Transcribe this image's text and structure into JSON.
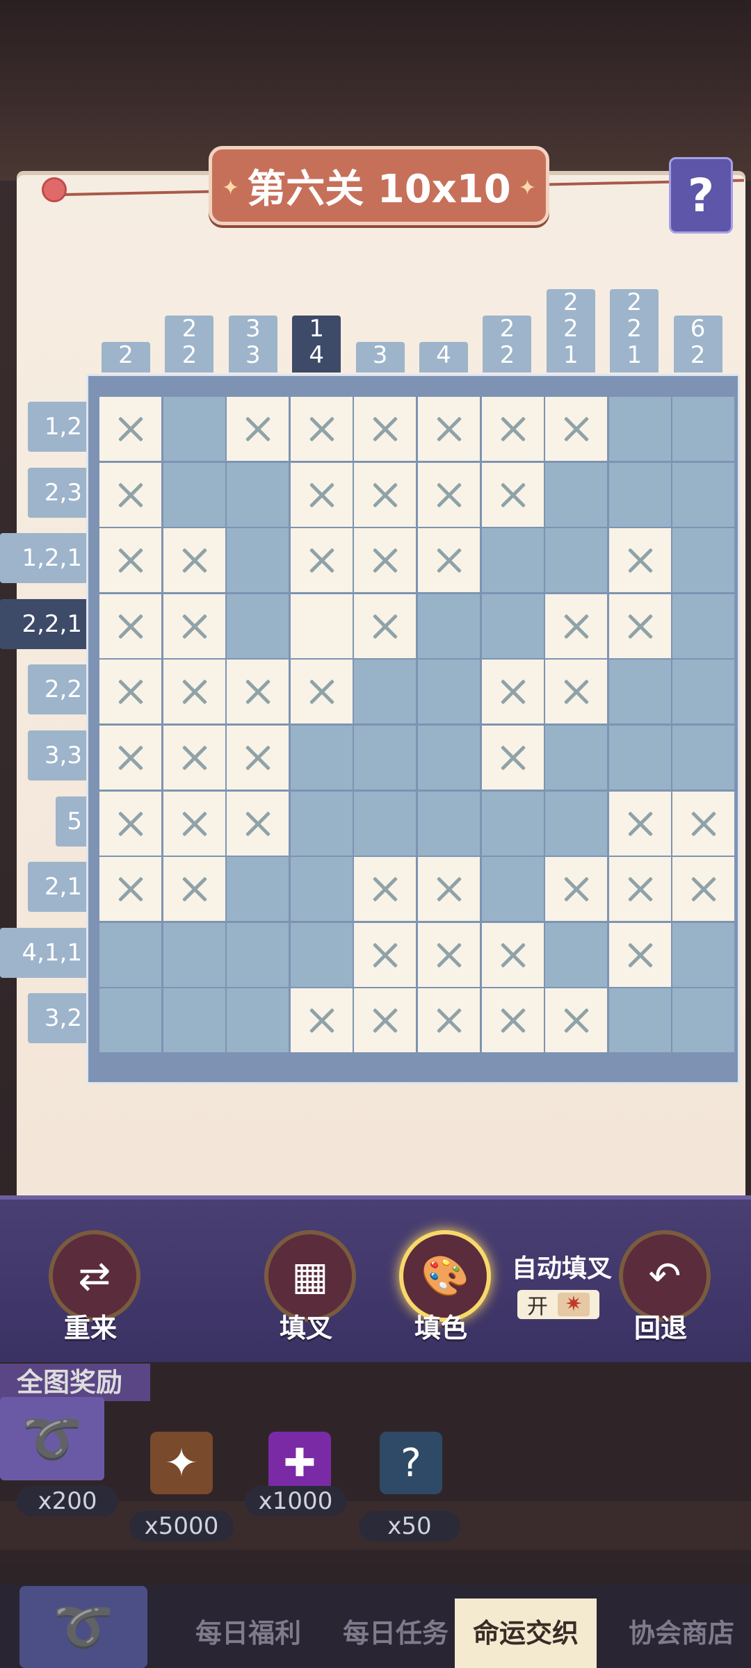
{
  "title": "第六关 10x10",
  "help_label": "?",
  "col_clues": [
    [
      "2"
    ],
    [
      "2",
      "2"
    ],
    [
      "3",
      "3"
    ],
    [
      "1",
      "4"
    ],
    [
      "3"
    ],
    [
      "4"
    ],
    [
      "2",
      "2"
    ],
    [
      "2",
      "2",
      "1"
    ],
    [
      "2",
      "2",
      "1"
    ],
    [
      "6",
      "2"
    ]
  ],
  "selected_col": 3,
  "row_clues": [
    "1,2",
    "2,3",
    "1,2,1",
    "2,2,1",
    "2,2",
    "3,3",
    "5",
    "2,1",
    "4,1,1",
    "3,2"
  ],
  "selected_row": 3,
  "grid": [
    "XFXXXXXXFF",
    "XFFXXXXFFF",
    "XXFXXXFFXF",
    "XXFEXFFXXF",
    "XXXXFFXXFF",
    "XXXFFFXFFF",
    "XXXFFFFFXX",
    "XXFFXXFXXX",
    "FFFFXXXFXF",
    "FFFXXXXXFF"
  ],
  "tools": {
    "reset": {
      "label": "重来",
      "icon": "reset-arrows-icon"
    },
    "cross": {
      "label": "填叉",
      "icon": "cross-grid-icon"
    },
    "color": {
      "label": "填色",
      "icon": "palette-icon"
    },
    "undo": {
      "label": "回退",
      "icon": "undo-icon"
    }
  },
  "auto_cross": {
    "label": "自动填叉",
    "state": "开"
  },
  "rewards": {
    "title": "全图奖励",
    "items": [
      {
        "icon": "feather-banner-icon",
        "count": "x200"
      },
      {
        "icon": "winged-emblem-icon",
        "count": "x5000"
      },
      {
        "icon": "puzzle-piece-icon",
        "count": "x1000"
      },
      {
        "icon": "mystery-card-icon",
        "count": "x50"
      }
    ]
  },
  "nav": {
    "tabs": [
      "每日福利",
      "每日任务",
      "命运交织",
      "协会商店"
    ],
    "selected": 2
  }
}
